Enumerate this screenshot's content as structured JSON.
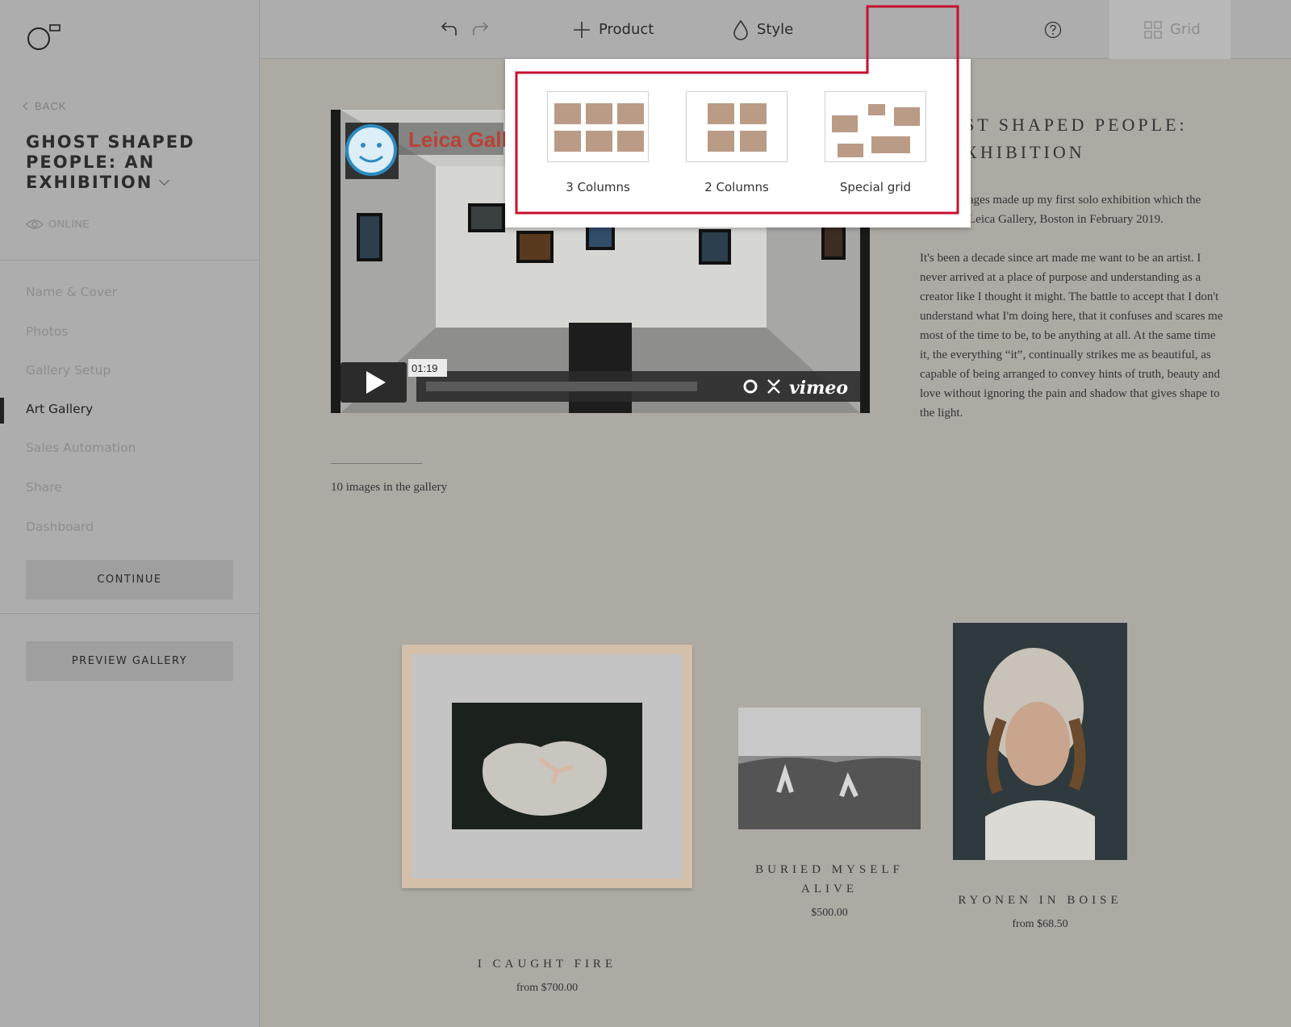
{
  "sidebar": {
    "back_label": "BACK",
    "gallery_title": "GHOST SHAPED PEOPLE: AN EXHIBITION",
    "status_label": "ONLINE",
    "nav_items": [
      {
        "label": "Name & Cover",
        "active": false
      },
      {
        "label": "Photos",
        "active": false
      },
      {
        "label": "Gallery Setup",
        "active": false
      },
      {
        "label": "Art Gallery",
        "active": true
      },
      {
        "label": "Sales Automation",
        "active": false
      },
      {
        "label": "Share",
        "active": false
      },
      {
        "label": "Dashboard",
        "active": false
      }
    ],
    "continue_label": "CONTINUE",
    "preview_label": "PREVIEW GALLERY"
  },
  "toolbar": {
    "undo_icon": "undo-icon",
    "redo_icon": "redo-icon",
    "product_label": "Product",
    "style_label": "Style",
    "grid_label": "Grid",
    "help_icon": "help-icon"
  },
  "grid_popup": {
    "options": [
      {
        "label": "3 Columns"
      },
      {
        "label": "2 Columns"
      },
      {
        "label": "Special grid"
      }
    ]
  },
  "video": {
    "overlay_title": "Leica Gall",
    "timestamp": "01:19",
    "brand": "vimeo"
  },
  "page": {
    "title_line1": "ST SHAPED PEOPLE:",
    "title_line2": "XHIBITION",
    "para1": "ages made up my first solo exhibition which the Leica Gallery, Boston in February 2019.",
    "para2": "It's been a decade since art made me want to be an artist. I never arrived at a place of purpose and understanding as a creator like I thought it might. The battle to accept that I don't understand what I'm doing here, that it confuses and scares me most of the time to be, to be anything at all. At the same time it, the everything “it”, continually strikes me as beautiful, as capable of being arranged to convey hints of truth, beauty and love without ignoring the pain and shadow that gives shape to the light.",
    "image_count": "10 images in the gallery"
  },
  "products": [
    {
      "title": "I CAUGHT FIRE",
      "price": "from $700.00"
    },
    {
      "title": "BURIED MYSELF ALIVE",
      "price": "$500.00"
    },
    {
      "title": "RYONEN IN BOISE",
      "price": "from $68.50"
    }
  ],
  "colors": {
    "accent": "#c8102e",
    "tile": "#b99b86"
  }
}
